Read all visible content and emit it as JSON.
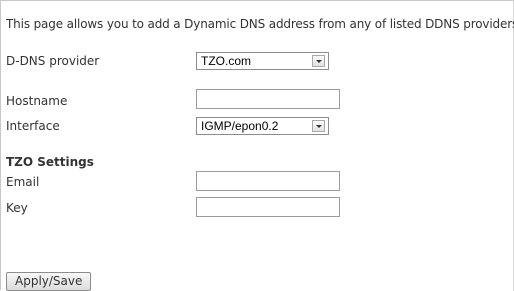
{
  "intro_text": "This page allows you to add a Dynamic DNS address from any of listed DDNS providers.",
  "ddns_provider": {
    "label": "D-DNS provider",
    "value": "TZO.com"
  },
  "hostname": {
    "label": "Hostname",
    "value": ""
  },
  "interface": {
    "label": "Interface",
    "value": "IGMP/epon0.2"
  },
  "tzo_settings": {
    "title": "TZO Settings",
    "email": {
      "label": "Email",
      "value": ""
    },
    "key": {
      "label": "Key",
      "value": ""
    }
  },
  "apply_button": {
    "label": "Apply/Save"
  }
}
